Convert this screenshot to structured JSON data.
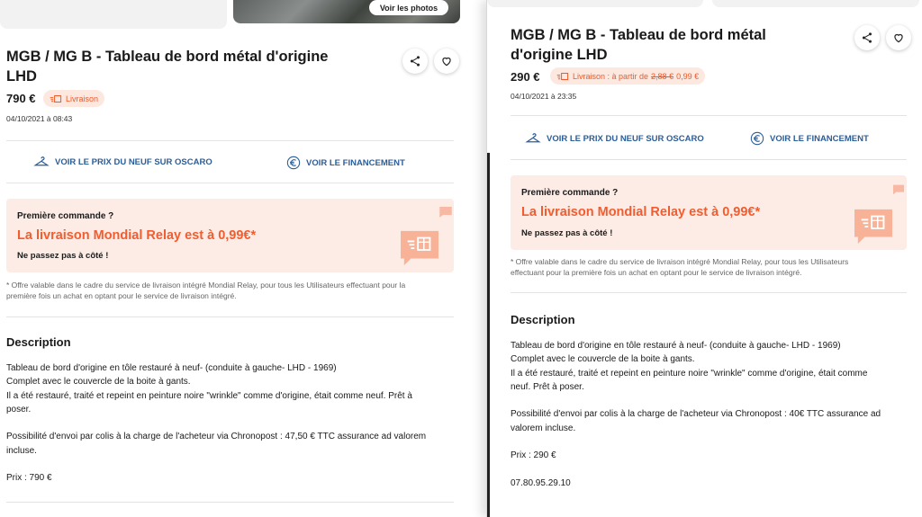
{
  "colors": {
    "accent_orange": "#f25c2e",
    "chip_bg": "#fde8df",
    "promo_bg": "#fdece5",
    "link_blue": "#2b5d99"
  },
  "icons": {
    "share": "share-icon",
    "favorite": "heart-icon",
    "delivery": "delivery-box-icon",
    "price_compare": "hanger-icon",
    "financing": "euro-icon",
    "promo_chat": "chat-box-icon"
  },
  "left": {
    "photos_button": "Voir les photos",
    "title_line1": "MGB / MG B - Tableau de bord métal d'origine",
    "title_line2": "LHD",
    "price": "790 €",
    "delivery_chip": "Livraison",
    "date": "04/10/2021 à 08:43",
    "link_price": "VOIR LE PRIX DU NEUF SUR OSCARO",
    "link_financing": "VOIR LE FINANCEMENT",
    "promo": {
      "line1": "Première commande ?",
      "line2": "La livraison Mondial Relay est à 0,99€*",
      "line3": "Ne passez pas à côté !"
    },
    "footnote_line1": "* Offre valable dans le cadre du service de livraison intégré Mondial Relay, pour tous les Utilisateurs effectuant pour la",
    "footnote_line2": "première fois un achat en optant pour le service de livraison intégré.",
    "description_title": "Description",
    "description_lines": [
      "Tableau de bord d'origine en tôle restauré à neuf- (conduite à gauche- LHD - 1969)",
      "Complet avec le couvercle de la boite à gants.",
      "Il a été restauré, traité et repeint en peinture noire \"wrinkle\" comme d'origine, était comme neuf. Prêt à",
      "poser.",
      "",
      "Possibilité d'envoi par colis à la charge de l'acheteur via Chronopost : 47,50 € TTC assurance ad valorem",
      "incluse.",
      "",
      "Prix : 790 €"
    ]
  },
  "right": {
    "title_line1": "MGB / MG B - Tableau de bord métal",
    "title_line2": "d'origine LHD",
    "price": "290 €",
    "delivery_chip": {
      "label": "Livraison : à partir de",
      "old_price": "2,88 €",
      "new_price": "0,99 €"
    },
    "date": "04/10/2021 à 23:35",
    "link_price": "VOIR LE PRIX DU NEUF SUR OSCARO",
    "link_financing": "VOIR LE FINANCEMENT",
    "promo": {
      "line1": "Première commande ?",
      "line2": "La livraison Mondial Relay est à 0,99€*",
      "line3": "Ne passez pas à côté !"
    },
    "footnote_line1": "* Offre valable dans le cadre du service de livraison intégré Mondial Relay, pour tous les Utilisateurs",
    "footnote_line2": "effectuant pour la première fois un achat en optant pour le service de livraison intégré.",
    "description_title": "Description",
    "description_lines": [
      "Tableau de bord d'origine en tôle restauré à neuf- (conduite à gauche- LHD - 1969)",
      "Complet avec le couvercle de la boite à gants.",
      "Il a été restauré, traité et repeint en peinture noire \"wrinkle\" comme d'origine, était comme",
      "neuf. Prêt à poser.",
      "",
      "Possibilité d'envoi par colis à la charge de l'acheteur via Chronopost : 40€ TTC assurance ad",
      "valorem incluse.",
      "",
      "Prix : 290 €",
      "",
      "07.80.95.29.10"
    ]
  }
}
